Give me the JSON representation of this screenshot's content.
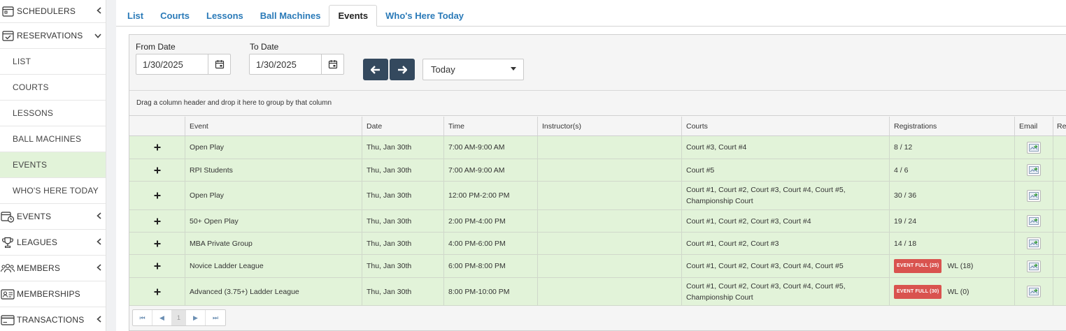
{
  "sidebar": {
    "items": [
      {
        "label": "SCHEDULERS",
        "icon": "calendar-icon",
        "type": "top",
        "chevron": "‹"
      },
      {
        "label": "RESERVATIONS",
        "icon": "calendar-check-icon",
        "type": "top",
        "chevron": "⌄"
      },
      {
        "label": "LIST",
        "type": "sub"
      },
      {
        "label": "COURTS",
        "type": "sub"
      },
      {
        "label": "LESSONS",
        "type": "sub"
      },
      {
        "label": "BALL MACHINES",
        "type": "sub"
      },
      {
        "label": "EVENTS",
        "type": "sub",
        "active": true
      },
      {
        "label": "WHO'S HERE TODAY",
        "type": "sub"
      },
      {
        "label": "EVENTS",
        "icon": "calendar-clock-icon",
        "type": "top",
        "chevron": "‹"
      },
      {
        "label": "LEAGUES",
        "icon": "trophy-icon",
        "type": "top",
        "chevron": "‹"
      },
      {
        "label": "MEMBERS",
        "icon": "people-icon",
        "type": "top",
        "chevron": "‹"
      },
      {
        "label": "MEMBERSHIPS",
        "icon": "id-card-icon",
        "type": "top",
        "chevron": ""
      },
      {
        "label": "TRANSACTIONS",
        "icon": "credit-card-icon",
        "type": "top",
        "chevron": "‹"
      }
    ]
  },
  "tabs": [
    {
      "label": "List"
    },
    {
      "label": "Courts"
    },
    {
      "label": "Lessons"
    },
    {
      "label": "Ball Machines"
    },
    {
      "label": "Events",
      "active": true
    },
    {
      "label": "Who's Here Today"
    }
  ],
  "filters": {
    "from_label": "From Date",
    "from_value": "1/30/2025",
    "to_label": "To Date",
    "to_value": "1/30/2025",
    "period": "Today"
  },
  "group_hint": "Drag a column header and drop it here to group by that column",
  "grid": {
    "columns": [
      "",
      "Event",
      "Date",
      "Time",
      "Instructor(s)",
      "Courts",
      "Registrations",
      "Email",
      "Re"
    ],
    "rows": [
      {
        "event": "Open Play",
        "date": "Thu, Jan 30th",
        "time": "7:00 AM-9:00 AM",
        "instructor": "",
        "courts": "Court #3, Court #4",
        "registrations": "8 / 12",
        "badge": "",
        "height": 33
      },
      {
        "event": "RPI Students",
        "date": "Thu, Jan 30th",
        "time": "7:00 AM-9:00 AM",
        "instructor": "",
        "courts": "Court #5",
        "registrations": "4 / 6",
        "badge": "",
        "height": 32
      },
      {
        "event": "Open Play",
        "date": "Thu, Jan 30th",
        "time": "12:00 PM-2:00 PM",
        "instructor": "",
        "courts": "Court #1, Court #2, Court #3, Court #4, Court #5, Championship Court",
        "registrations": "30 / 36",
        "badge": "",
        "height": 41
      },
      {
        "event": "50+ Open Play",
        "date": "Thu, Jan 30th",
        "time": "2:00 PM-4:00 PM",
        "instructor": "",
        "courts": "Court #1, Court #2, Court #3, Court #4",
        "registrations": "19 / 24",
        "badge": "",
        "height": 32
      },
      {
        "event": "MBA Private Group",
        "date": "Thu, Jan 30th",
        "time": "4:00 PM-6:00 PM",
        "instructor": "",
        "courts": "Court #1, Court #2, Court #3",
        "registrations": "14 / 18",
        "badge": "",
        "height": 32
      },
      {
        "event": "Novice Ladder League",
        "date": "Thu, Jan 30th",
        "time": "6:00 PM-8:00 PM",
        "instructor": "",
        "courts": "Court #1, Court #2, Court #3, Court #4, Court #5",
        "registrations": "WL (18)",
        "badge": "EVENT FULL (25)",
        "height": 33
      },
      {
        "event": "Advanced (3.75+) Ladder League",
        "date": "Thu, Jan 30th",
        "time": "8:00 PM-10:00 PM",
        "instructor": "",
        "courts": "Court #1, Court #2, Court #3, Court #4, Court #5, Championship Court",
        "registrations": "WL (0)",
        "badge": "EVENT FULL (30)",
        "height": 40
      }
    ]
  },
  "pager": {
    "first": "⏮",
    "prev": "◀",
    "page": "1",
    "next": "▶",
    "last": "⏭"
  },
  "colors": {
    "accent": "#2a7ab8",
    "row_bg": "#e2f3d9",
    "nav_btn": "#34495e",
    "badge": "#d9534f"
  }
}
